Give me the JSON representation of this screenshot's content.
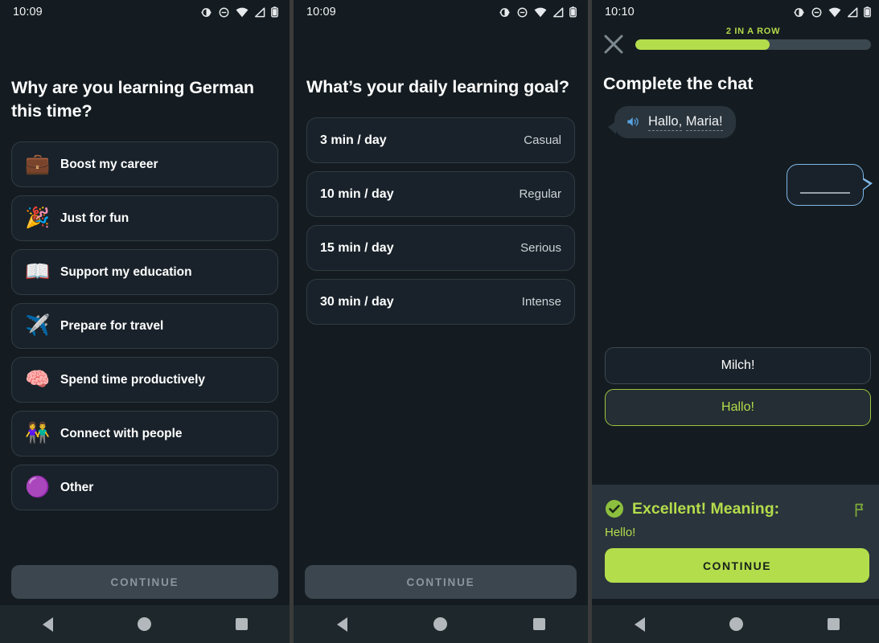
{
  "statusbar": {
    "time_left": "10:09",
    "time_mid": "10:09",
    "time_right": "10:10",
    "icons": [
      "brightness-icon",
      "dnd-icon",
      "wifi-icon",
      "signal-icon",
      "battery-icon"
    ]
  },
  "panel1": {
    "question": "Why are you learning German this time?",
    "options": [
      {
        "emoji": "💼",
        "icon_name": "briefcase-emoji",
        "label": "Boost my career"
      },
      {
        "emoji": "🎉",
        "icon_name": "party-popper-emoji",
        "label": "Just for fun"
      },
      {
        "emoji": "📖",
        "icon_name": "open-book-emoji",
        "label": "Support my education"
      },
      {
        "emoji": "✈️",
        "icon_name": "airplane-emoji",
        "label": "Prepare for travel"
      },
      {
        "emoji": "🧠",
        "icon_name": "brain-emoji",
        "label": "Spend time productively"
      },
      {
        "emoji": "👫",
        "icon_name": "people-emoji",
        "label": "Connect with people"
      },
      {
        "emoji": "🟣",
        "icon_name": "ellipsis-circle-emoji",
        "label": "Other"
      }
    ],
    "continue_label": "CONTINUE"
  },
  "panel2": {
    "question": "What’s your daily learning goal?",
    "goals": [
      {
        "duration": "3 min / day",
        "intensity": "Casual"
      },
      {
        "duration": "10 min / day",
        "intensity": "Regular"
      },
      {
        "duration": "15 min / day",
        "intensity": "Serious"
      },
      {
        "duration": "30 min / day",
        "intensity": "Intense"
      }
    ],
    "continue_label": "CONTINUE"
  },
  "panel3": {
    "streak_label": "2 IN A ROW",
    "progress_percent": 57,
    "close_icon": "close-icon",
    "title": "Complete the chat",
    "incoming_message": {
      "word1": "Hallo,",
      "word2": "Maria!",
      "speaker_icon": "speaker-icon"
    },
    "answers": [
      {
        "label": "Milch!",
        "selected": false
      },
      {
        "label": "Hallo!",
        "selected": true
      }
    ],
    "feedback": {
      "title": "Excellent! Meaning:",
      "body": "Hello!",
      "check_icon": "check-circle-icon",
      "flag_icon": "report-flag-icon"
    },
    "continue_label": "CONTINUE"
  },
  "colors": {
    "background": "#141c21",
    "card": "#19222a",
    "accent_green": "#b4dd4c",
    "feedback_panel": "#2a343c",
    "bubble_border_blue": "#7fb7e8",
    "disabled_button": "#3b464e"
  }
}
